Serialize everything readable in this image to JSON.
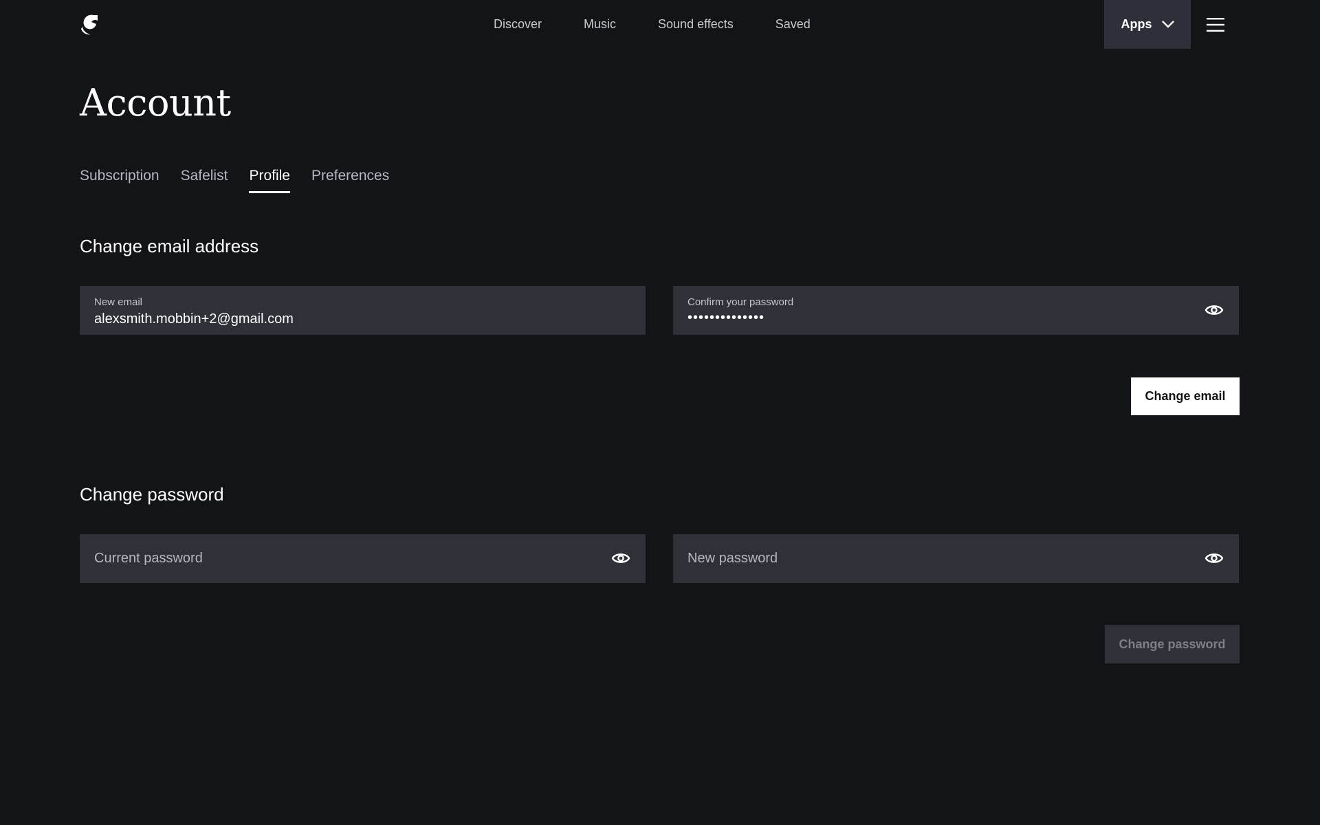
{
  "header": {
    "nav": [
      {
        "label": "Discover"
      },
      {
        "label": "Music"
      },
      {
        "label": "Sound effects"
      },
      {
        "label": "Saved"
      }
    ],
    "apps_label": "Apps"
  },
  "page": {
    "title": "Account"
  },
  "tabs": [
    {
      "label": "Subscription",
      "active": false
    },
    {
      "label": "Safelist",
      "active": false
    },
    {
      "label": "Profile",
      "active": true
    },
    {
      "label": "Preferences",
      "active": false
    }
  ],
  "email_section": {
    "title": "Change email address",
    "new_email_label": "New email",
    "new_email_value": "alexsmith.mobbin+2@gmail.com",
    "confirm_password_label": "Confirm your password",
    "confirm_password_mask": "••••••••••••••",
    "submit_label": "Change email"
  },
  "password_section": {
    "title": "Change password",
    "current_password_placeholder": "Current password",
    "new_password_placeholder": "New password",
    "submit_label": "Change password"
  },
  "colors": {
    "background": "#131418",
    "field": "#2f3138",
    "apps_button": "#2d3038",
    "primary_button": "#ffffff",
    "disabled_text": "#7c7f86"
  }
}
